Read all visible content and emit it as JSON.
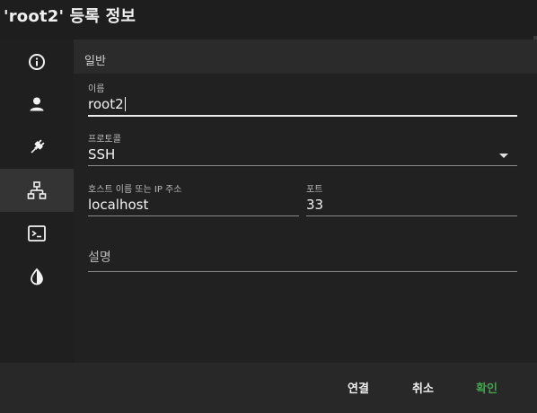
{
  "dialog": {
    "title": "'root2' 등록 정보"
  },
  "sidebar": {
    "items": [
      {
        "icon": "info-icon",
        "active": false
      },
      {
        "icon": "person-icon",
        "active": false
      },
      {
        "icon": "plug-icon",
        "active": false
      },
      {
        "icon": "network-icon",
        "active": true
      },
      {
        "icon": "terminal-icon",
        "active": false
      },
      {
        "icon": "contrast-icon",
        "active": false
      }
    ]
  },
  "section": {
    "label": "일반"
  },
  "form": {
    "name": {
      "label": "이름",
      "value": "root2"
    },
    "protocol": {
      "label": "프로토콜",
      "value": "SSH"
    },
    "host": {
      "label": "호스트 이름 또는 IP 주소",
      "value": "localhost"
    },
    "port": {
      "label": "포트",
      "value": "33"
    },
    "description": {
      "placeholder": "설명",
      "value": ""
    }
  },
  "footer": {
    "connect_label": "연결",
    "cancel_label": "취소",
    "ok_label": "확인"
  },
  "colors": {
    "background": "#1e1e1e",
    "active_sidebar": "#343434",
    "confirm_accent": "#3fa34d"
  }
}
